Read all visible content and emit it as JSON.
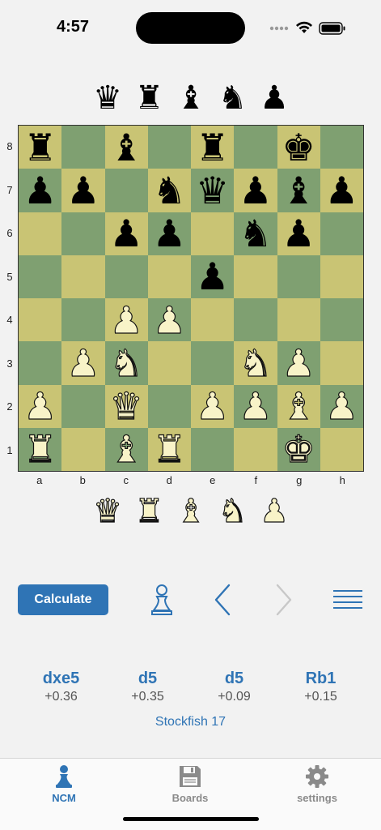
{
  "status_bar": {
    "time": "4:57"
  },
  "top_picker": [
    {
      "name": "black-queen",
      "glyph": "♛"
    },
    {
      "name": "black-rook",
      "glyph": "♜"
    },
    {
      "name": "black-bishop",
      "glyph": "♝"
    },
    {
      "name": "black-knight",
      "glyph": "♞"
    },
    {
      "name": "black-pawn",
      "glyph": "♟"
    }
  ],
  "bottom_picker": [
    {
      "name": "white-queen",
      "glyph": "♛"
    },
    {
      "name": "white-rook",
      "glyph": "♜"
    },
    {
      "name": "white-bishop",
      "glyph": "♝"
    },
    {
      "name": "white-knight",
      "glyph": "♞"
    },
    {
      "name": "white-pawn",
      "glyph": "♟"
    }
  ],
  "board": {
    "files": [
      "a",
      "b",
      "c",
      "d",
      "e",
      "f",
      "g",
      "h"
    ],
    "ranks": [
      "8",
      "7",
      "6",
      "5",
      "4",
      "3",
      "2",
      "1"
    ],
    "position": [
      [
        "bR",
        "",
        "bB",
        "",
        "bR",
        "",
        "bK",
        ""
      ],
      [
        "bP",
        "bP",
        "",
        "bN",
        "bQ",
        "bP",
        "bB",
        "bP"
      ],
      [
        "",
        "",
        "bP",
        "bP",
        "",
        "bN",
        "bP",
        ""
      ],
      [
        "",
        "",
        "",
        "",
        "bP",
        "",
        "",
        ""
      ],
      [
        "",
        "",
        "wP",
        "wP",
        "",
        "",
        "",
        ""
      ],
      [
        "",
        "wP",
        "wN",
        "",
        "",
        "wN",
        "wP",
        ""
      ],
      [
        "wP",
        "",
        "wQ",
        "",
        "wP",
        "wP",
        "wB",
        "wP"
      ],
      [
        "wR",
        "",
        "wB",
        "wR",
        "",
        "",
        "wK",
        ""
      ]
    ],
    "glyphs": {
      "K": "♚",
      "Q": "♛",
      "R": "♜",
      "B": "♝",
      "N": "♞",
      "P": "♟"
    }
  },
  "controls": {
    "calculate_label": "Calculate",
    "accent_color": "#2f74b5"
  },
  "analysis": {
    "lines": [
      {
        "move": "dxe5",
        "eval": "+0.36"
      },
      {
        "move": "d5",
        "eval": "+0.35"
      },
      {
        "move": "d5",
        "eval": "+0.09"
      },
      {
        "move": "Rb1",
        "eval": "+0.15"
      }
    ],
    "engine": "Stockfish 17"
  },
  "tabs": [
    {
      "label": "NCM",
      "icon": "pawn-icon",
      "active": true
    },
    {
      "label": "Boards",
      "icon": "floppy-disk-icon",
      "active": false
    },
    {
      "label": "settings",
      "icon": "gear-icon",
      "active": false
    }
  ]
}
